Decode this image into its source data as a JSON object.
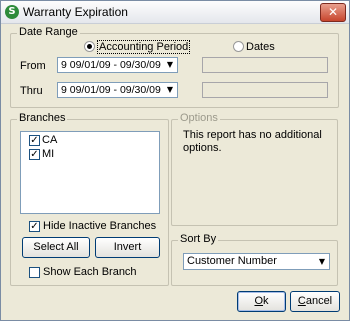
{
  "window": {
    "title": "Warranty Expiration",
    "close_glyph": "✕",
    "icon_letter": "S"
  },
  "date_range": {
    "label": "Date Range",
    "mode_accounting_label": "Accounting Period",
    "mode_dates_label": "Dates",
    "from_label": "From",
    "thru_label": "Thru",
    "from_value": "9  09/01/09 - 09/30/09",
    "thru_value": "9  09/01/09 - 09/30/09",
    "arrow": "▼"
  },
  "branches": {
    "label": "Branches",
    "items": [
      {
        "label": "CA",
        "checked": true
      },
      {
        "label": "MI",
        "checked": true
      }
    ],
    "hide_inactive_label": "Hide Inactive Branches",
    "select_all_label": "Select All",
    "invert_label": "Invert",
    "show_each_label": "Show Each Branch",
    "check_glyph": "✓"
  },
  "options": {
    "label": "Options",
    "message": "This report has no additional options."
  },
  "sort_by": {
    "label": "Sort By",
    "value": "Customer Number",
    "arrow": "▼"
  },
  "buttons": {
    "ok_first": "O",
    "ok_rest": "k",
    "cancel_first": "C",
    "cancel_rest": "ancel"
  }
}
